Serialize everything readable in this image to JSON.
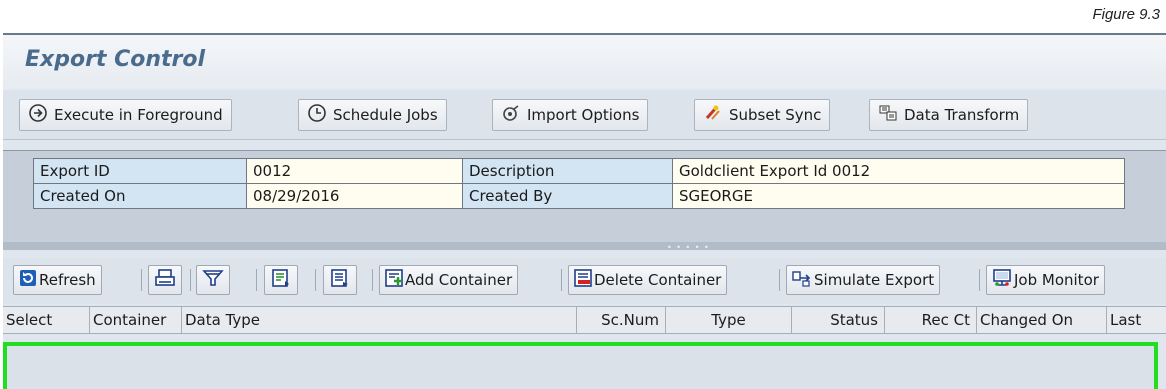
{
  "figure_label": "Figure 9.3",
  "window": {
    "title": "Export Control"
  },
  "app_toolbar": [
    {
      "id": "execute",
      "label": "Execute in Foreground",
      "icon": "execute-icon"
    },
    {
      "id": "schedule",
      "label": "Schedule Jobs",
      "icon": "clock-icon"
    },
    {
      "id": "import",
      "label": "Import Options",
      "icon": "settings-icon"
    },
    {
      "id": "subset",
      "label": "Subset Sync",
      "icon": "sync-icon"
    },
    {
      "id": "transform",
      "label": "Data Transform",
      "icon": "transform-icon"
    }
  ],
  "header": {
    "export_id_label": "Export ID",
    "export_id_value": "0012",
    "description_label": "Description",
    "description_value": "Goldclient Export Id 0012",
    "created_on_label": "Created On",
    "created_on_value": "08/29/2016",
    "created_by_label": "Created By",
    "created_by_value": "SGEORGE"
  },
  "grid_toolbar": {
    "refresh": "Refresh",
    "add_container": "Add Container",
    "delete_container": "Delete Container",
    "simulate_export": "Simulate Export",
    "job_monitor": "Job Monitor"
  },
  "columns": [
    "Select",
    "Container",
    "Data Type",
    "Sc.Num",
    "Type",
    "Status",
    "Rec Ct",
    "Changed On",
    "Last"
  ],
  "colors": {
    "title": "#4a6b8c",
    "label_cell": "#d3e4f3",
    "value_cell": "#fffdf0",
    "selection_border": "#22dd22"
  }
}
